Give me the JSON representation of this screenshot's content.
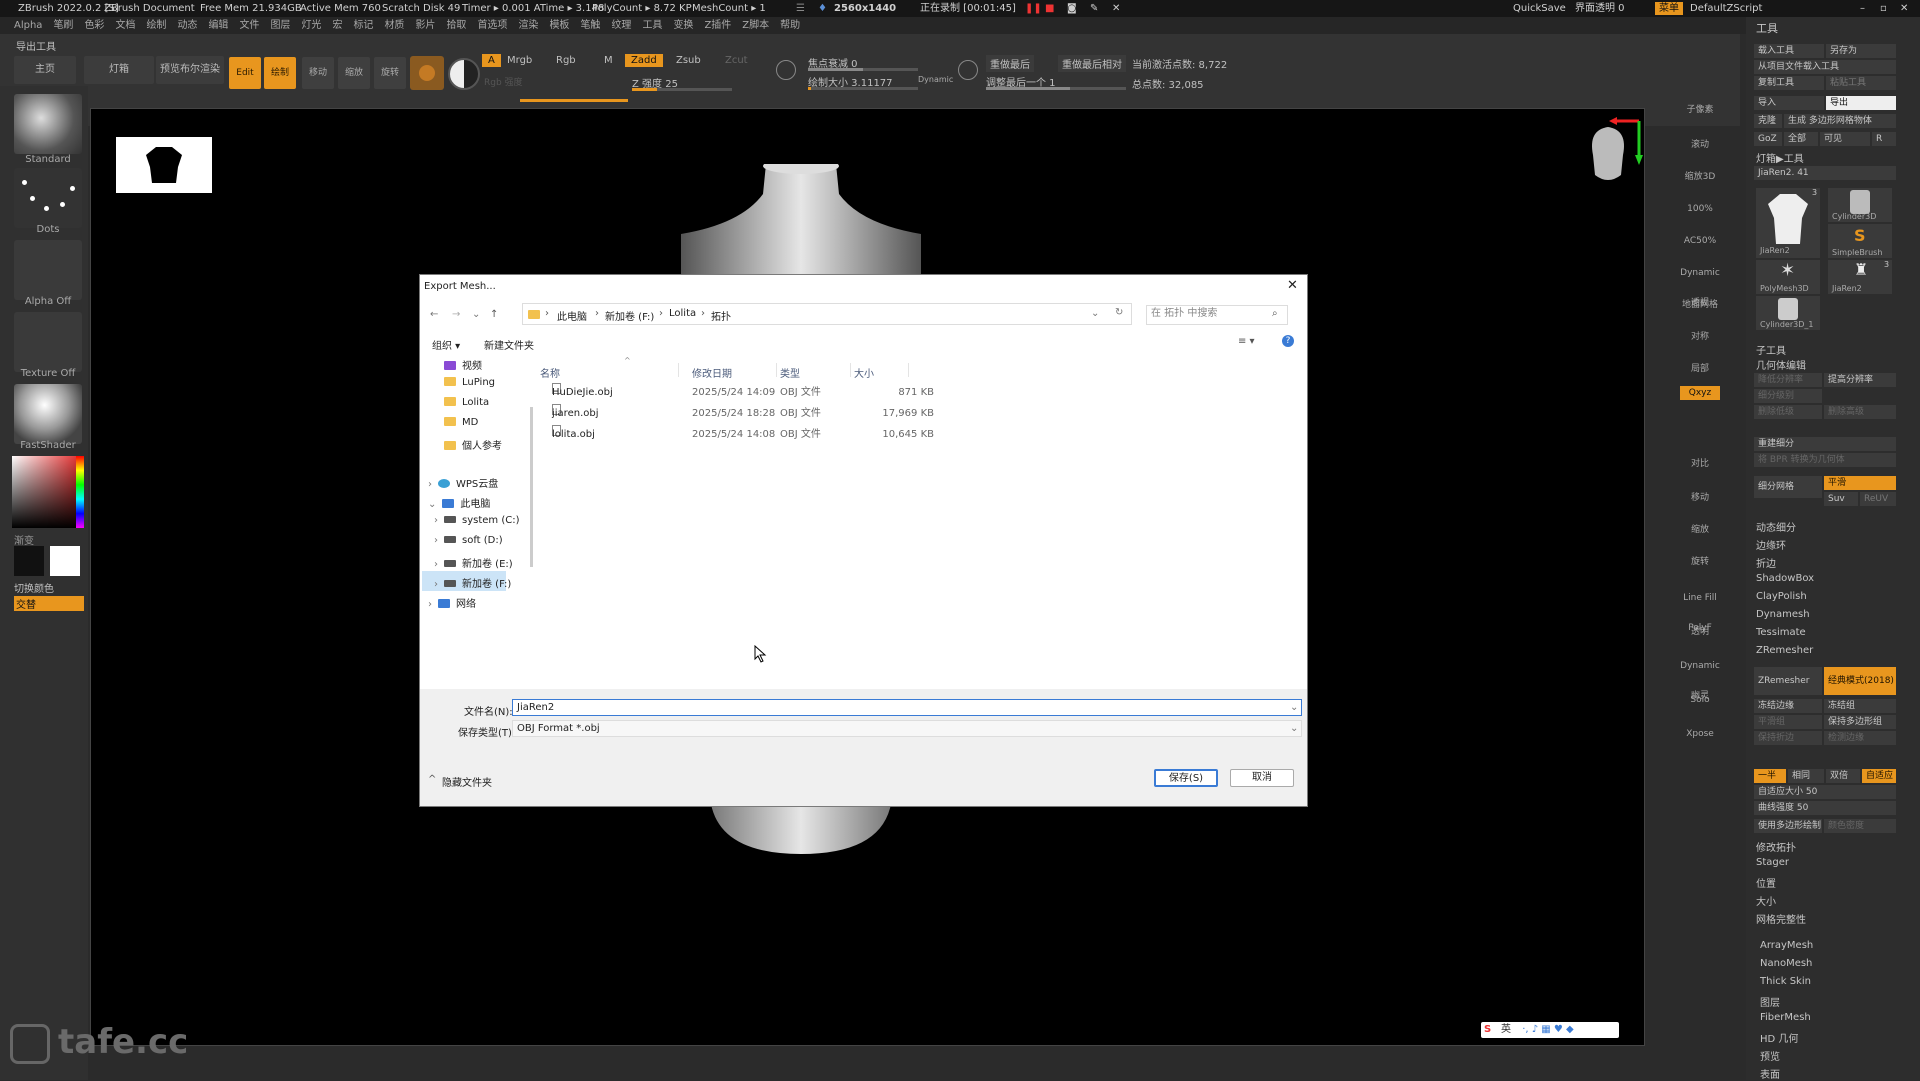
{
  "titlebar": {
    "app": "ZBrush 2022.0.2 [S]",
    "doc": "ZBrush Document",
    "free_mem": "Free Mem 21.934GB",
    "active_mem": "Active Mem 760",
    "scratch": "Scratch Disk 49",
    "timer": "Timer ▸ 0.001 ATime ▸ 3.148",
    "polycount": "PolyCount ▸ 8.72 KP",
    "meshcount": "MeshCount ▸ 1",
    "resolution": "2560x1440",
    "recording": "正在录制 [00:01:45]",
    "quicksave": "QuickSave",
    "interface": "界面透明 0",
    "menu": "菜单",
    "script": "DefaultZScript"
  },
  "menubar": [
    "Alpha",
    "笔刷",
    "色彩",
    "文档",
    "绘制",
    "动态",
    "编辑",
    "文件",
    "图层",
    "灯光",
    "宏",
    "标记",
    "材质",
    "影片",
    "拾取",
    "首选项",
    "渲染",
    "模板",
    "笔触",
    "纹理",
    "工具",
    "变换",
    "Z插件",
    "Z脚本",
    "帮助"
  ],
  "toolbar": {
    "export_tool": "导出工具",
    "home": "主页",
    "lightbox": "灯箱",
    "bpr": "预览布尔渲染",
    "edit": "Edit",
    "draw": "绘制",
    "move": "移动",
    "scale": "缩放",
    "rotate": "旋转",
    "a": "A",
    "mrgb": "Mrgb",
    "rgb": "Rgb",
    "m": "M",
    "zadd": "Zadd",
    "zsub": "Zsub",
    "zcut": "Zcut",
    "rgb_intensity": "Rgb 强度",
    "z_intensity": "Z 强度 25",
    "focal_shift": "焦点衰减 0",
    "draw_size": "绘制大小 3.11177",
    "dynamic": "Dynamic",
    "replay_last": "重做最后",
    "replay_last_rel": "重做最后相对",
    "adjust_last": "调整最后一个 1",
    "active_points": "当前激活点数: 8,722",
    "total_points": "总点数: 32,085"
  },
  "leftpanel": {
    "standard": "Standard",
    "dots": "Dots",
    "alpha_off": "Alpha Off",
    "texture_off": "Texture Off",
    "fastshader": "FastShader",
    "gradient": "渐变",
    "switch_color": "切换颜色",
    "alternate": "交替"
  },
  "right_icons": [
    "子像素",
    "滚动",
    "缩放3D",
    "100%",
    "AC50%",
    "Dynamic 透视",
    "地面网格",
    "对称",
    "局部",
    "Qxyz",
    "",
    "",
    "对比",
    "移动",
    "缩放",
    "旋转",
    "Line Fill PolyF",
    "透明",
    "Dynamic 幽灵",
    "Solo",
    "Xpose"
  ],
  "rightpanel": {
    "tool_title": "工具",
    "load_tool": "载入工具",
    "save_as": "另存为",
    "load_from_project": "从项目文件载入工具",
    "copy_tool": "复制工具",
    "paste_tool": "粘贴工具",
    "import": "导入",
    "export": "导出",
    "clone": "克隆",
    "make_polymesh": "生成 多边形网格物体",
    "goz": "GoZ",
    "all": "全部",
    "visible": "可见",
    "r": "R",
    "lightbox_tools": "灯箱▶工具",
    "current_tool": "JiaRen2. 41",
    "thumbs": [
      {
        "name": "JiaRen2",
        "badge": "3"
      },
      {
        "name": "Cylinder3D",
        "badge": ""
      },
      {
        "name": "",
        "badge": ""
      },
      {
        "name": "SimpleBrush",
        "badge": ""
      },
      {
        "name": "PolyMesh3D",
        "badge": ""
      },
      {
        "name": "JiaRen2",
        "badge": "3"
      },
      {
        "name": "Cylinder3D_1",
        "badge": ""
      }
    ],
    "subtool": "子工具",
    "geometry": "几何体编辑",
    "lower_res": "降低分辨率",
    "higher_res": "提高分辨率",
    "sdiv": "细分级别",
    "del_lower": "删除低级",
    "del_higher": "删除高级",
    "reconstruct": "重建细分",
    "convert_bpr": "将 BPR 转换为几何体",
    "divide": "细分网格",
    "smooth": "平滑",
    "suv": "Suv",
    "reuv": "ReUV",
    "dynamic_subdiv": "动态细分",
    "edgeloop": "边缘环",
    "crease": "折边",
    "shadowbox": "ShadowBox",
    "claypolish": "ClayPolish",
    "dynamesh": "Dynamesh",
    "tessimate": "Tessimate",
    "zremesher_title": "ZRemesher",
    "zremesher_btn": "ZRemesher",
    "legacy": "经典模式(2018)",
    "freeze_border": "冻结边缘",
    "freeze_groups": "冻结组",
    "smooth_groups": "平滑组",
    "keep_groups": "保持多边形组",
    "keep_creases": "保持折边",
    "detect_edges": "检测边缘",
    "half": "一半",
    "same": "相同",
    "double": "双倍",
    "adaptive": "自适应",
    "adaptive_size": "自适应大小 50",
    "curve_strength": "曲线强度 50",
    "use_polypaint": "使用多边形绘制",
    "color_density": "颜色密度",
    "modify_topology": "修改拓扑",
    "stager": "Stager",
    "position": "位置",
    "size": "大小",
    "mesh_integrity": "网格完整性",
    "arraymesh": "ArrayMesh",
    "nanomesh": "NanoMesh",
    "thickskin": "Thick Skin",
    "layers": "图层",
    "fibermesh": "FiberMesh",
    "hd_geometry": "HD 几何",
    "preview": "预览",
    "surface": "表面"
  },
  "dialog": {
    "title": "Export Mesh...",
    "path": [
      "此电脑",
      "新加卷 (F:)",
      "Lolita",
      "拓扑"
    ],
    "search_placeholder": "在 拓扑 中搜索",
    "organize": "组织 ▾",
    "new_folder": "新建文件夹",
    "columns": {
      "name": "名称",
      "date": "修改日期",
      "type": "类型",
      "size": "大小"
    },
    "files": [
      {
        "name": "HuDieJie.obj",
        "date": "2025/5/24 14:09",
        "type": "OBJ 文件",
        "size": "871 KB"
      },
      {
        "name": "jiaren.obj",
        "date": "2025/5/24 18:28",
        "type": "OBJ 文件",
        "size": "17,969 KB"
      },
      {
        "name": "lolita.obj",
        "date": "2025/5/24 14:08",
        "type": "OBJ 文件",
        "size": "10,645 KB"
      }
    ],
    "tree": [
      {
        "label": "视频",
        "kind": "video",
        "indent": 0
      },
      {
        "label": "LuPing",
        "kind": "folder",
        "indent": 0
      },
      {
        "label": "Lolita",
        "kind": "folder",
        "indent": 0
      },
      {
        "label": "MD",
        "kind": "folder",
        "indent": 0
      },
      {
        "label": "個人参考",
        "kind": "folder",
        "indent": 0
      },
      {
        "label": "WPS云盘",
        "kind": "cloud",
        "indent": 0
      },
      {
        "label": "此电脑",
        "kind": "pc",
        "indent": 0
      },
      {
        "label": "system (C:)",
        "kind": "drive",
        "indent": 1
      },
      {
        "label": "soft (D:)",
        "kind": "drive",
        "indent": 1
      },
      {
        "label": "新加卷 (E:)",
        "kind": "drive",
        "indent": 1
      },
      {
        "label": "新加卷 (F:)",
        "kind": "drive",
        "indent": 1
      },
      {
        "label": "网络",
        "kind": "network",
        "indent": 0
      }
    ],
    "filename_label": "文件名(N):",
    "filename_value": "JiaRen2",
    "filetype_label": "保存类型(T):",
    "filetype_value": "OBJ Format *.obj",
    "hide_folders": "隐藏文件夹",
    "save": "保存(S)",
    "cancel": "取消"
  },
  "watermark": "tafe.cc",
  "ime": "英",
  "colors": {
    "accent": "#e8961e",
    "ui_bg": "#2b2b2b",
    "dialog_bg": "#ffffff"
  }
}
